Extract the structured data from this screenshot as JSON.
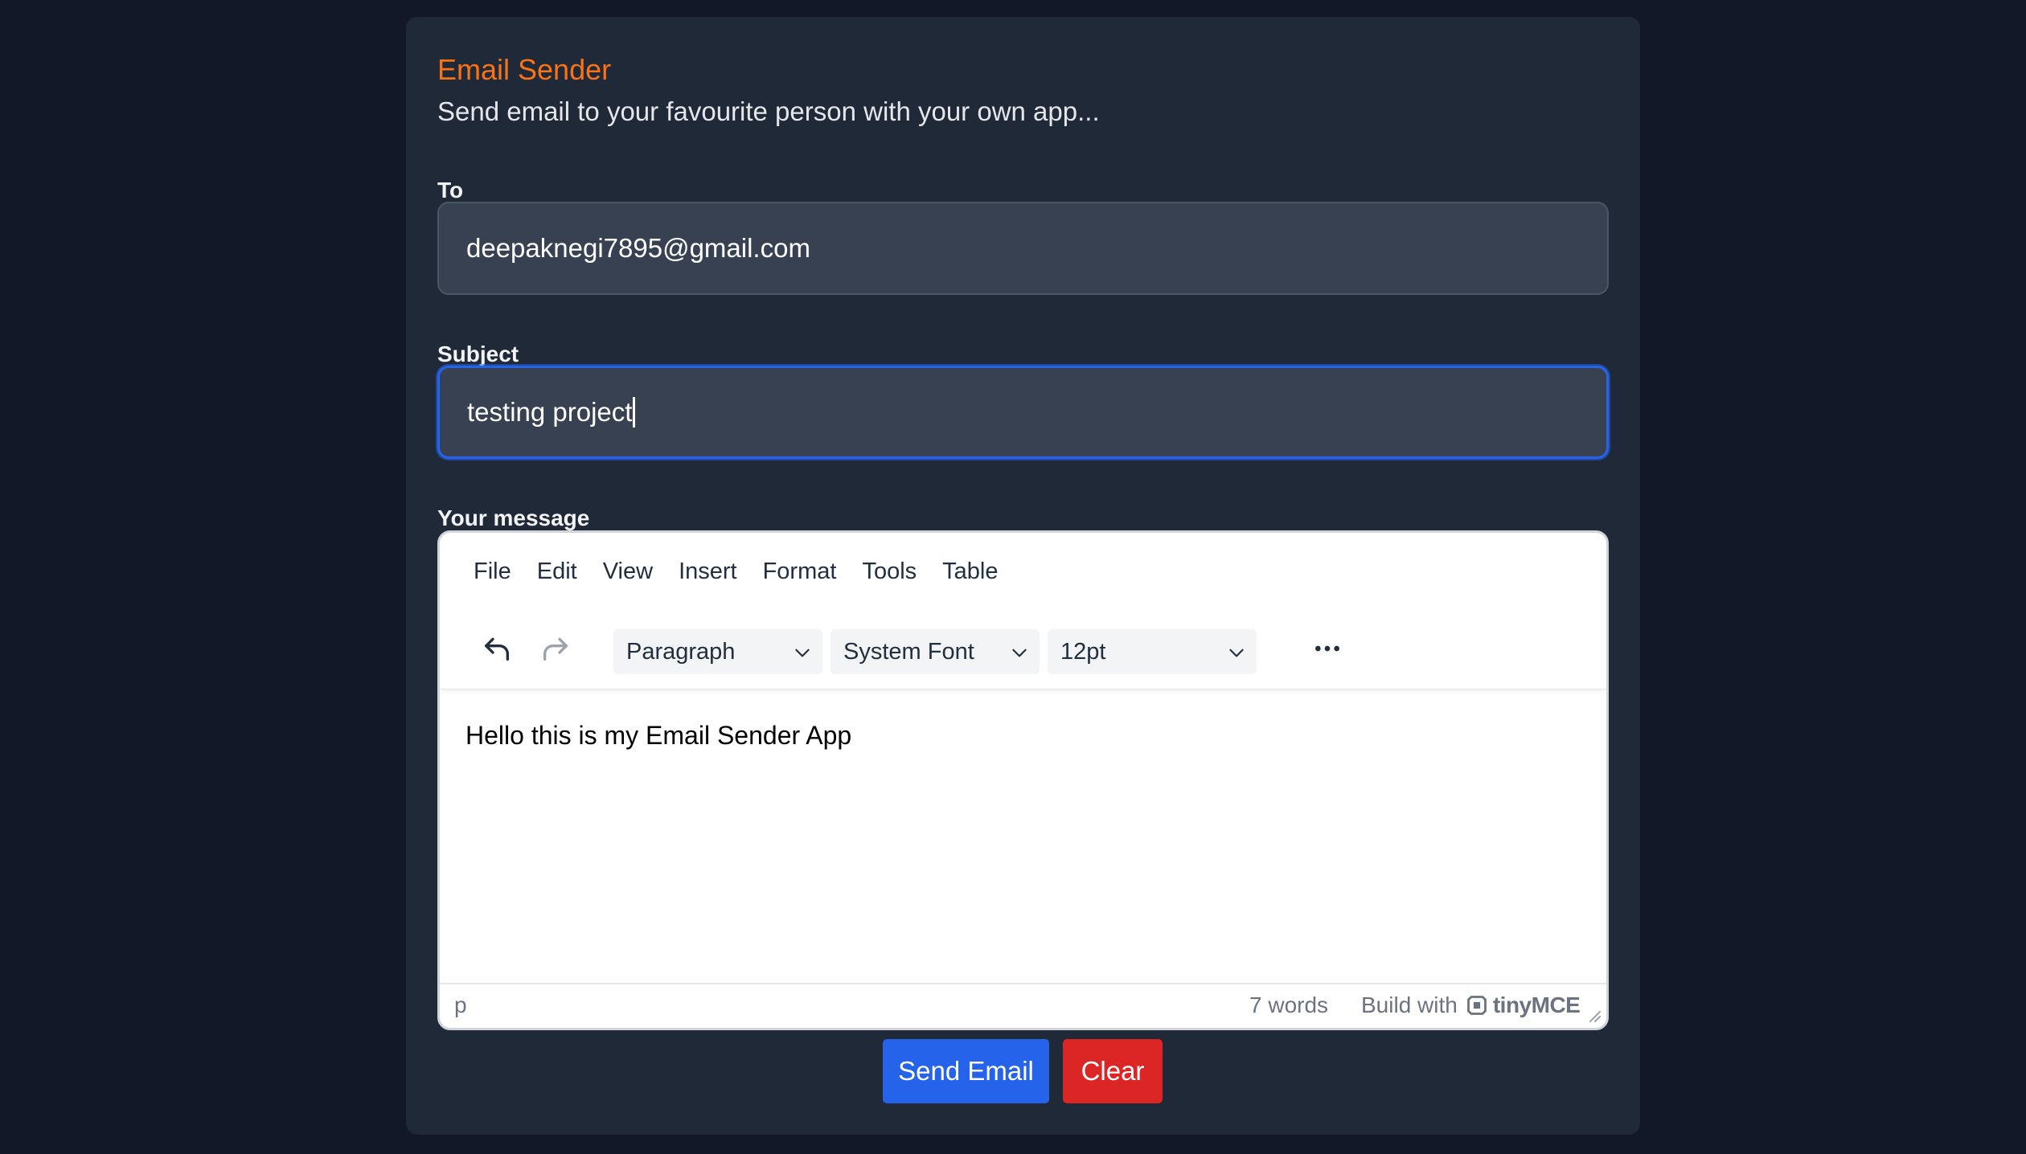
{
  "header": {
    "title": "Email Sender",
    "subtitle": "Send email to your favourite person with your own app..."
  },
  "form": {
    "to": {
      "label": "To",
      "value": "deepaknegi7895@gmail.com"
    },
    "subject": {
      "label": "Subject",
      "value": "testing project"
    },
    "message": {
      "label": "Your message"
    }
  },
  "editor": {
    "menu": [
      "File",
      "Edit",
      "View",
      "Insert",
      "Format",
      "Tools",
      "Table"
    ],
    "toolbar": {
      "block_format": "Paragraph",
      "font_family": "System Font",
      "font_size": "12pt",
      "icons": [
        "undo-icon",
        "redo-icon",
        "more-icon"
      ]
    },
    "content": "Hello this is my Email Sender App",
    "status": {
      "path": "p",
      "word_count": "7 words",
      "build_with": "Build with",
      "brand": "tinyMCE"
    }
  },
  "actions": {
    "send": "Send Email",
    "clear": "Clear"
  },
  "colors": {
    "page_bg": "#111827",
    "card_bg": "#1f2937",
    "title": "#f97316",
    "field_bg": "#374151",
    "focus": "#2563eb",
    "send": "#2563eb",
    "clear": "#dc2626"
  }
}
